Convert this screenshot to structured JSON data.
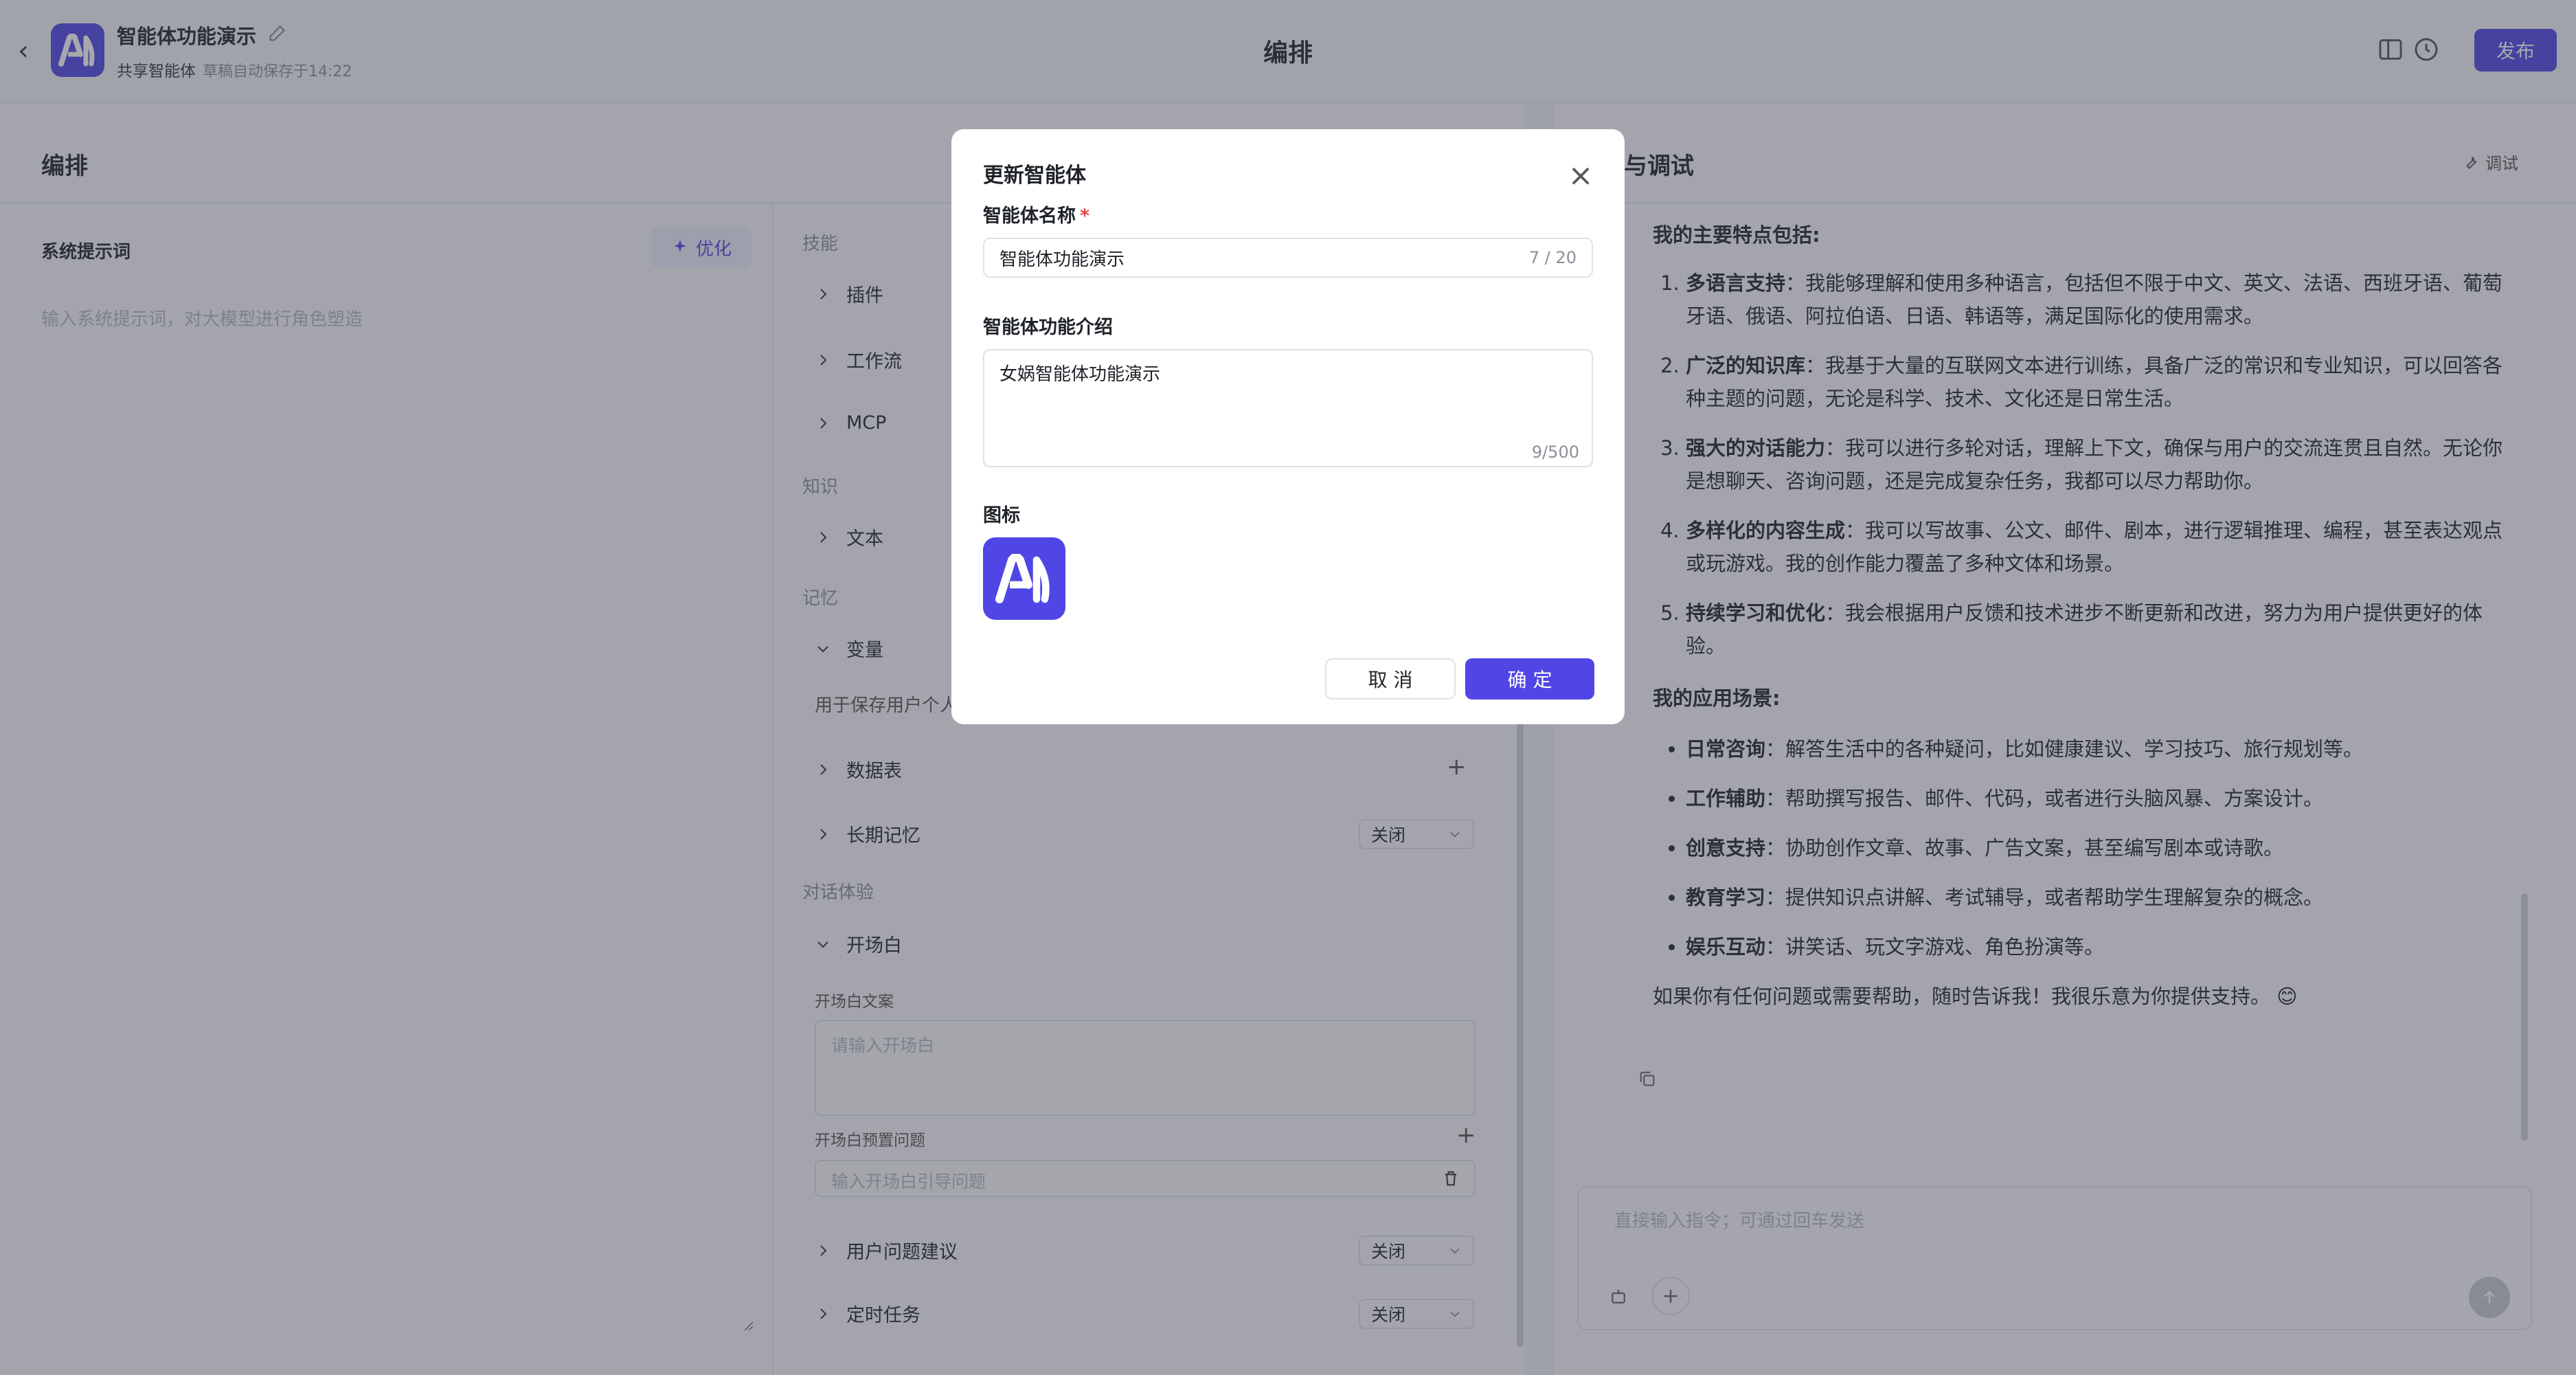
{
  "header": {
    "app_name": "智能体功能演示",
    "shared_label": "共享智能体",
    "autosave": "草稿自动保存于14:22",
    "center_title": "编排",
    "publish_label": "发布"
  },
  "left": {
    "title": "编排",
    "system_prompt_label": "系统提示词",
    "optimize_label": "优化",
    "system_prompt_placeholder": "输入系统提示词，对大模型进行角色塑造",
    "groups": {
      "skills": "技能",
      "knowledge": "知识",
      "memory": "记忆",
      "dialog": "对话体验"
    },
    "rows": {
      "plugin": "插件",
      "workflow": "工作流",
      "mcp": "MCP",
      "text": "文本",
      "variable": "变量",
      "variable_desc": "用于保存用户个人",
      "database": "数据表",
      "long_memory": "长期记忆",
      "opener": "开场白",
      "opener_text_label": "开场白文案",
      "opener_placeholder": "请输入开场白",
      "preset_label": "开场白预置问题",
      "preset_placeholder": "输入开场白引导问题",
      "suggestion": "用户问题建议",
      "schedule": "定时任务"
    },
    "off_value": "关闭"
  },
  "right": {
    "title": "与调试",
    "debug_label": "调试",
    "intro": "我的主要特点包括:",
    "features": [
      {
        "bold": "多语言支持",
        "text": "：我能够理解和使用多种语言，包括但不限于中文、英文、法语、西班牙语、葡萄牙语、俄语、阿拉伯语、日语、韩语等，满足国际化的使用需求。"
      },
      {
        "bold": "广泛的知识库",
        "text": "：我基于大量的互联网文本进行训练，具备广泛的常识和专业知识，可以回答各种主题的问题，无论是科学、技术、文化还是日常生活。"
      },
      {
        "bold": "强大的对话能力",
        "text": "：我可以进行多轮对话，理解上下文，确保与用户的交流连贯且自然。无论你是想聊天、咨询问题，还是完成复杂任务，我都可以尽力帮助你。"
      },
      {
        "bold": "多样化的内容生成",
        "text": "：我可以写故事、公文、邮件、剧本，进行逻辑推理、编程，甚至表达观点或玩游戏。我的创作能力覆盖了多种文体和场景。"
      },
      {
        "bold": "持续学习和优化",
        "text": "：我会根据用户反馈和技术进步不断更新和改进，努力为用户提供更好的体验。"
      }
    ],
    "scenes_title": "我的应用场景:",
    "scenes": [
      {
        "bold": "日常咨询",
        "text": "：解答生活中的各种疑问，比如健康建议、学习技巧、旅行规划等。"
      },
      {
        "bold": "工作辅助",
        "text": "：帮助撰写报告、邮件、代码，或者进行头脑风暴、方案设计。"
      },
      {
        "bold": "创意支持",
        "text": "：协助创作文章、故事、广告文案，甚至编写剧本或诗歌。"
      },
      {
        "bold": "教育学习",
        "text": "：提供知识点讲解、考试辅导，或者帮助学生理解复杂的概念。"
      },
      {
        "bold": "娱乐互动",
        "text": "：讲笑话、玩文字游戏、角色扮演等。"
      }
    ],
    "closing": "如果你有任何问题或需要帮助，随时告诉我！我很乐意为你提供支持。 😊",
    "input_placeholder": "直接输入指令；可通过回车发送"
  },
  "modal": {
    "title": "更新智能体",
    "name_label": "智能体名称",
    "name_value": "智能体功能演示",
    "name_count": "7 / 20",
    "desc_label": "智能体功能介绍",
    "desc_value": "女娲智能体功能演示",
    "desc_count": "9/500",
    "icon_label": "图标",
    "cancel_label": "取 消",
    "ok_label": "确 定"
  },
  "colors": {
    "accent": "#4f46e5",
    "required": "#e5484d"
  }
}
